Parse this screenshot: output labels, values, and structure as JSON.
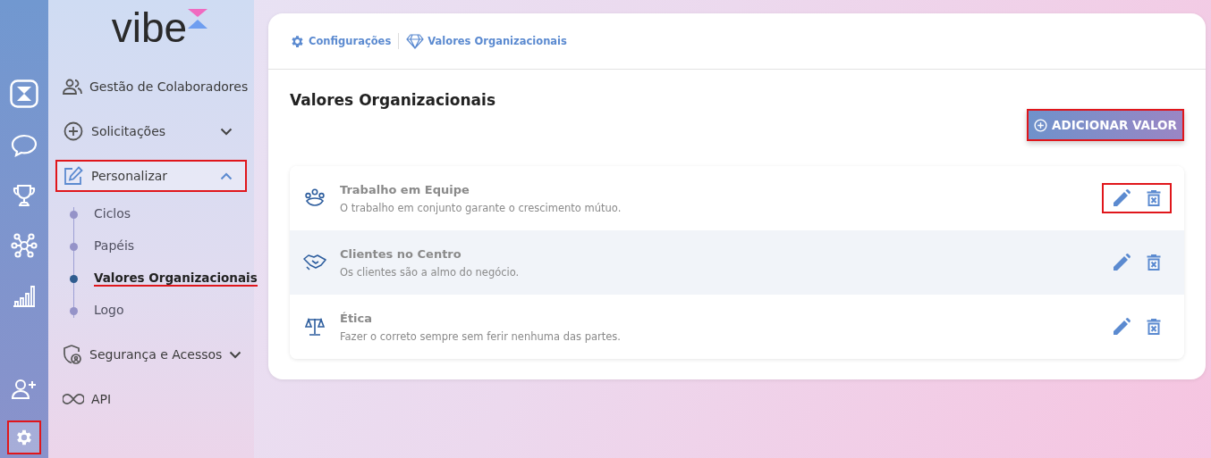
{
  "rail": {
    "top": [
      {
        "kind": "logo",
        "selected": false,
        "highlighted": false
      },
      {
        "kind": "chat",
        "selected": false,
        "highlighted": false
      },
      {
        "kind": "trophy",
        "selected": false,
        "highlighted": false
      },
      {
        "kind": "network",
        "selected": false,
        "highlighted": false
      },
      {
        "kind": "chart",
        "selected": false,
        "highlighted": false
      }
    ],
    "bottom": [
      {
        "kind": "add-user",
        "selected": false,
        "highlighted": false
      },
      {
        "kind": "gear",
        "selected": true,
        "highlighted": true
      }
    ]
  },
  "sidebar": {
    "logo": "vibe",
    "items": [
      {
        "label": "Gestão de Colaboradores",
        "kind": "people",
        "highlighted": false
      },
      {
        "label": "Solicitações",
        "kind": "requests",
        "expanded": false,
        "highlighted": false
      },
      {
        "label": "Personalizar",
        "kind": "customize",
        "expanded": true,
        "highlighted": true,
        "children": [
          {
            "label": "Ciclos",
            "selected": false,
            "highlighted": false
          },
          {
            "label": "Papéis",
            "selected": false,
            "highlighted": false
          },
          {
            "label": "Valores Organizacionais",
            "selected": true,
            "highlighted": true
          },
          {
            "label": "Logo",
            "selected": false,
            "highlighted": false
          }
        ]
      },
      {
        "label": "Segurança e Acessos",
        "kind": "security",
        "expanded": false,
        "highlighted": false
      },
      {
        "label": "API",
        "kind": "api",
        "highlighted": false
      }
    ]
  },
  "breadcrumb": [
    {
      "label": "Configurações",
      "kind": "settings"
    },
    {
      "label": "Valores Organizacionais",
      "kind": "values"
    }
  ],
  "page_title": "Valores Organizacionais",
  "add_button": {
    "label": "ADICIONAR VALOR",
    "highlighted": true
  },
  "values": [
    {
      "title": "Trabalho em Equipe",
      "description": "O trabalho em conjunto garante o crescimento mútuo.",
      "kind": "team",
      "hovered": false,
      "actions_highlighted": true
    },
    {
      "title": "Clientes no Centro",
      "description": "Os clientes são a almo do negócio.",
      "kind": "clients",
      "hovered": true,
      "actions_highlighted": false
    },
    {
      "title": "Ética",
      "description": "Fazer o correto sempre sem ferir nenhuma das partes.",
      "kind": "ethics",
      "hovered": false,
      "actions_highlighted": false
    }
  ]
}
